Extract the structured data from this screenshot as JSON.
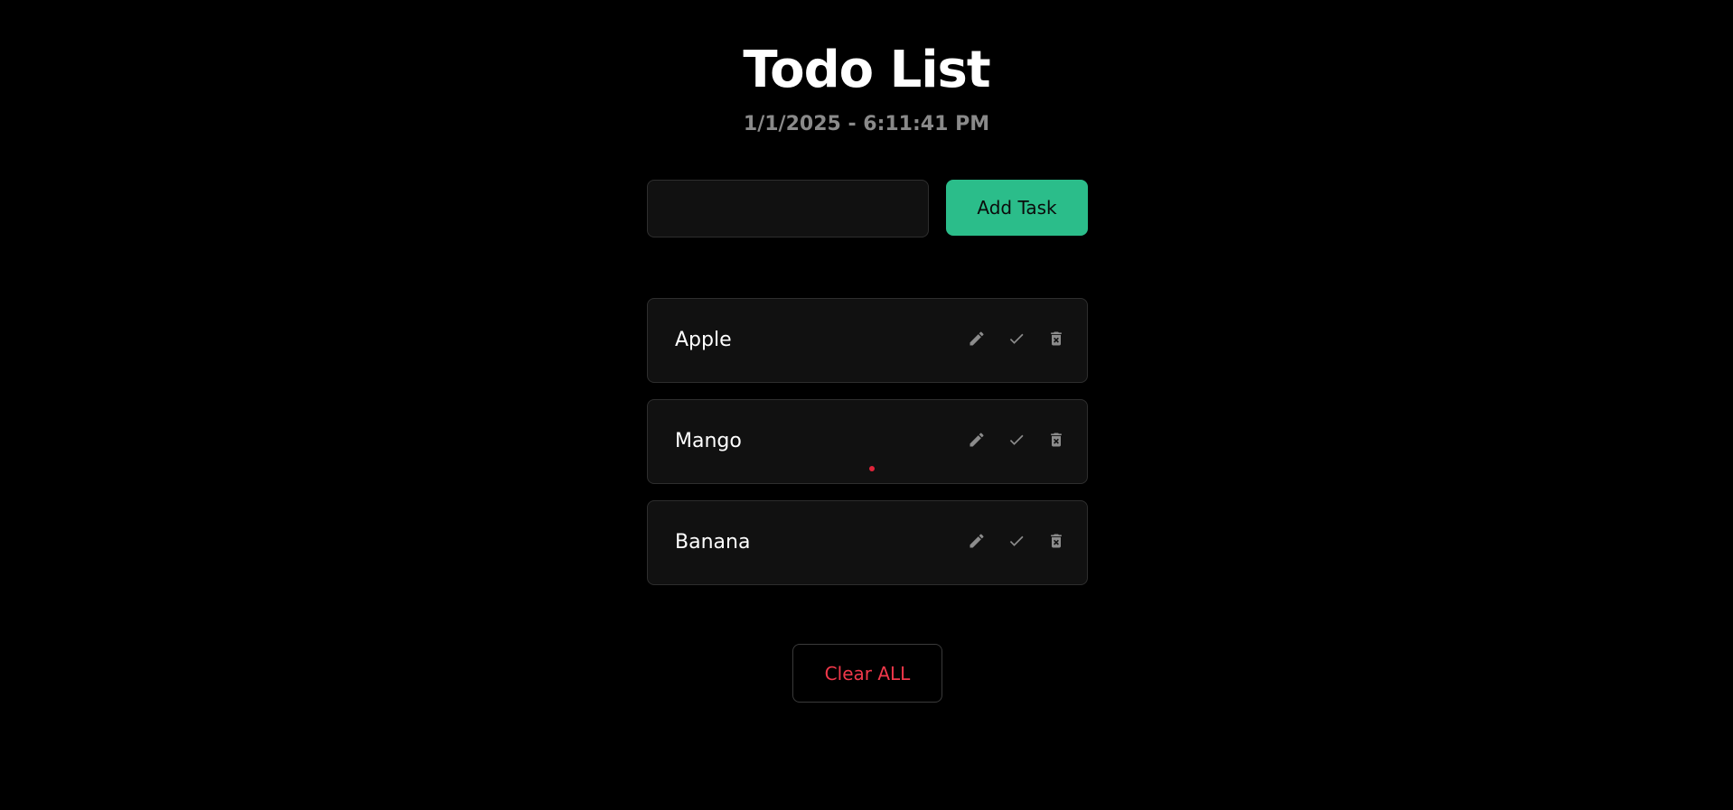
{
  "header": {
    "title": "Todo List",
    "timestamp": "1/1/2025 - 6:11:41 PM"
  },
  "input": {
    "value": "",
    "placeholder": ""
  },
  "add_button": {
    "label": "Add Task"
  },
  "tasks": [
    {
      "label": "Apple",
      "actions": [
        "pencil-icon",
        "check-icon",
        "trash-icon"
      ]
    },
    {
      "label": "Mango",
      "actions": [
        "pencil-icon",
        "check-icon",
        "trash-icon"
      ]
    },
    {
      "label": "Banana",
      "actions": [
        "pencil-icon",
        "check-icon",
        "trash-icon"
      ]
    }
  ],
  "clear_button": {
    "label": "Clear ALL"
  },
  "colors": {
    "background": "#000000",
    "accent": "#2bbd8a",
    "danger": "#f0384a",
    "card": "#111111",
    "muted_text": "#8a8a8a"
  }
}
